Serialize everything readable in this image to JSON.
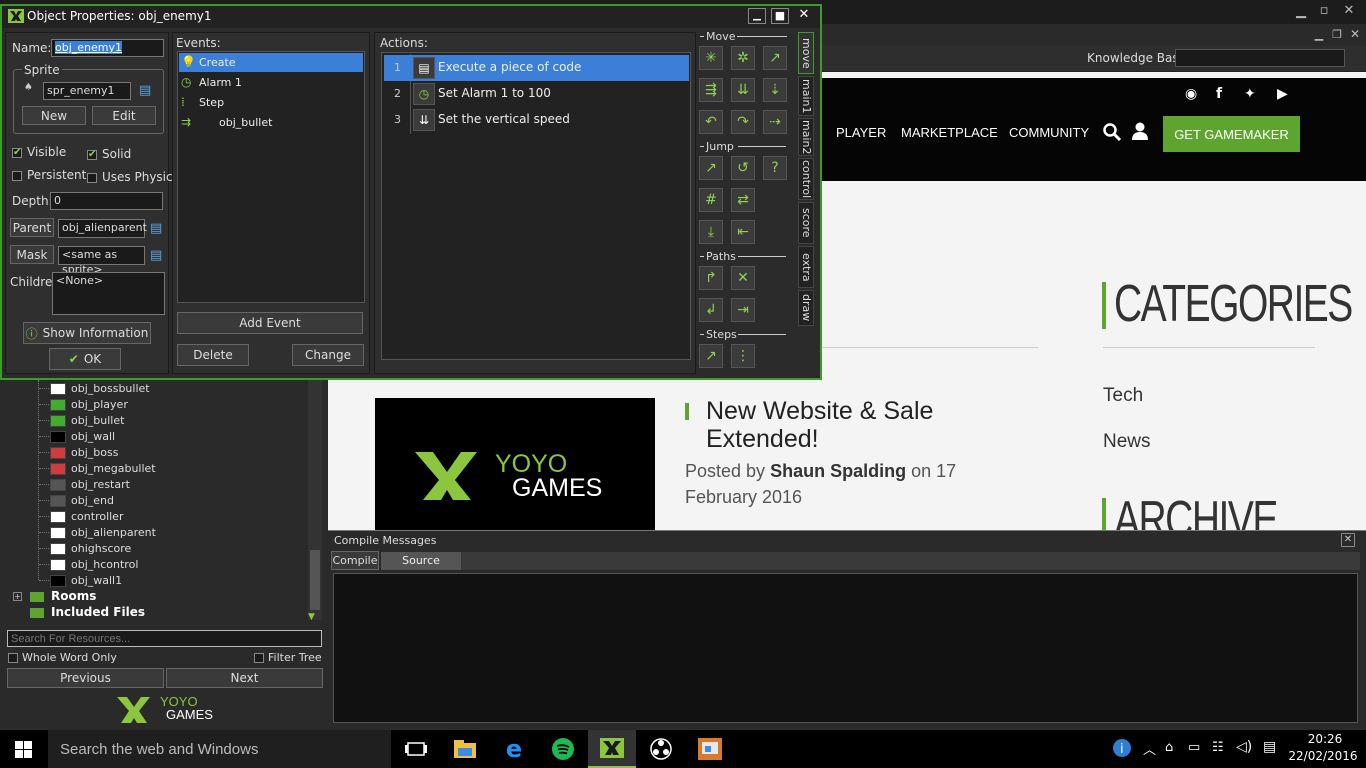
{
  "dialog": {
    "title": "Object Properties: obj_enemy1",
    "name_label": "Name:",
    "name_value": "obj_enemy1",
    "sprite_group": "Sprite",
    "sprite_value": "spr_enemy1",
    "new_label": "New",
    "edit_label": "Edit",
    "visible_label": "Visible",
    "visible_checked": true,
    "solid_label": "Solid",
    "solid_checked": true,
    "persistent_label": "Persistent",
    "persistent_checked": false,
    "physics_label": "Uses Physics",
    "physics_checked": false,
    "depth_label": "Depth:",
    "depth_value": "0",
    "parent_label": "Parent",
    "parent_value": "obj_alienparent",
    "mask_label": "Mask",
    "mask_value": "<same as sprite>",
    "children_label": "Children:",
    "children_value": "<None>",
    "show_info_label": "Show Information",
    "ok_label": "OK",
    "events_label": "Events:",
    "events": [
      {
        "label": "Create",
        "icon": "lightbulb-icon",
        "selected": true
      },
      {
        "label": "Alarm 1",
        "icon": "clock-icon",
        "selected": false
      },
      {
        "label": "Step",
        "icon": "steps-icon",
        "selected": false
      },
      {
        "label": "obj_bullet",
        "icon": "collision-icon",
        "selected": false
      }
    ],
    "add_event_label": "Add Event",
    "delete_label": "Delete",
    "change_label": "Change",
    "actions_label": "Actions:",
    "actions": [
      {
        "num": "1",
        "label": "Execute a piece of code",
        "icon": "code-icon",
        "selected": true
      },
      {
        "num": "2",
        "label": "Set Alarm 1 to 100",
        "icon": "clock-icon",
        "selected": false
      },
      {
        "num": "3",
        "label": "Set the vertical speed",
        "icon": "vspeed-icon",
        "selected": false
      }
    ],
    "sections": {
      "move": "Move",
      "jump": "Jump",
      "paths": "Paths",
      "steps": "Steps"
    },
    "tabs": [
      "move",
      "main1",
      "main2",
      "control",
      "score",
      "extra",
      "draw"
    ]
  },
  "resources": {
    "items": [
      {
        "label": "obj_bossbullet",
        "color": "#ffffff"
      },
      {
        "label": "obj_player",
        "color": "#3fae2a"
      },
      {
        "label": "obj_bullet",
        "color": "#3fae2a"
      },
      {
        "label": "obj_wall",
        "color": "#000000"
      },
      {
        "label": "obj_boss",
        "color": "#d23b3b"
      },
      {
        "label": "obj_megabullet",
        "color": "#d23b3b"
      },
      {
        "label": "obj_restart",
        "color": "#555555"
      },
      {
        "label": "obj_end",
        "color": "#555555"
      },
      {
        "label": "controller",
        "color": "#ffffff"
      },
      {
        "label": "obj_alienparent",
        "color": "#ffffff"
      },
      {
        "label": "ohighscore",
        "color": "#ffffff"
      },
      {
        "label": "obj_hcontrol",
        "color": "#ffffff"
      },
      {
        "label": "obj_wall1",
        "color": "#000000"
      }
    ],
    "rooms_label": "Rooms",
    "included_label": "Included Files",
    "search_placeholder": "Search For Resources...",
    "whole_word_label": "Whole Word Only",
    "filter_tree_label": "Filter Tree",
    "previous_label": "Previous",
    "next_label": "Next",
    "logo_text_1": "YOYO",
    "logo_text_2": "GAMES"
  },
  "kb": {
    "label": "Knowledge Base:"
  },
  "web": {
    "nav": [
      "PLAYER",
      "MARKETPLACE",
      "COMMUNITY"
    ],
    "get_label": "GET GAMEMAKER",
    "categories_heading": "CATEGORIES",
    "archive_heading": "ARCHIVE",
    "categories": [
      "Tech",
      "News"
    ],
    "post_title": "New Website & Sale Extended!",
    "post_meta_prefix": "Posted by",
    "post_author": "Shaun Spalding",
    "post_meta_suffix": "on 17 February 2016",
    "logo_text_1": "YOYO",
    "logo_text_2": "GAMES",
    "accent": "#5da52f"
  },
  "compile": {
    "title": "Compile Messages",
    "tabs": [
      "Compile",
      "Source Control"
    ]
  },
  "taskbar": {
    "search_placeholder": "Search the web and Windows",
    "time": "20:26",
    "date": "22/02/2016"
  }
}
